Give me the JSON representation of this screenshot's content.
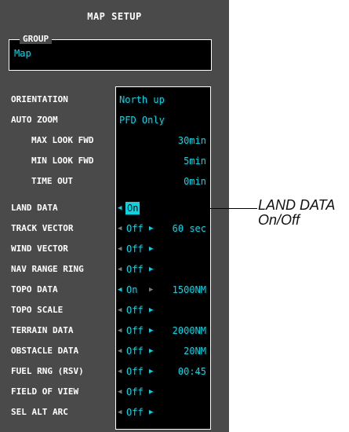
{
  "panel": {
    "title": "MAP SETUP"
  },
  "group": {
    "label": "GROUP",
    "value": "Map"
  },
  "settings": [
    {
      "label": "ORIENTATION",
      "value": "North up"
    },
    {
      "label": "AUTO ZOOM",
      "value": "PFD Only"
    },
    {
      "label": "MAX LOOK FWD",
      "value": "30min"
    },
    {
      "label": "MIN LOOK FWD",
      "value": "5min"
    },
    {
      "label": "TIME OUT",
      "value": "0min"
    },
    {
      "label": "LAND DATA",
      "value": "On"
    },
    {
      "label": "TRACK VECTOR",
      "value": "Off",
      "range": "60 sec"
    },
    {
      "label": "WIND VECTOR",
      "value": "Off"
    },
    {
      "label": "NAV RANGE RING",
      "value": "Off"
    },
    {
      "label": "TOPO DATA",
      "value": "On",
      "range": "1500NM"
    },
    {
      "label": "TOPO SCALE",
      "value": "Off"
    },
    {
      "label": "TERRAIN DATA",
      "value": "Off",
      "range": "2000NM"
    },
    {
      "label": "OBSTACLE DATA",
      "value": "Off",
      "range": "20NM"
    },
    {
      "label": "FUEL RNG (RSV)",
      "value": "Off",
      "range": "00:45"
    },
    {
      "label": "FIELD OF VIEW",
      "value": "Off"
    },
    {
      "label": "SEL ALT ARC",
      "value": "Off"
    }
  ],
  "callout": {
    "line1": "LAND DATA",
    "line2": "On/Off"
  },
  "colors": {
    "panel_bg": "#4a4a4a",
    "cyan": "#00d8e8",
    "dim": "#7a7a7a",
    "black": "#000000"
  }
}
